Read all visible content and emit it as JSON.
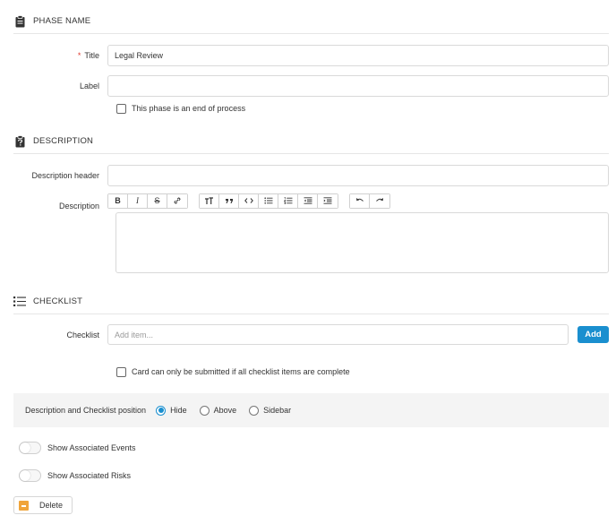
{
  "phase": {
    "section_title": "PHASE NAME",
    "title_label": "Title",
    "title_required_mark": "*",
    "title_value": "Legal Review",
    "label_label": "Label",
    "label_value": "",
    "end_of_process_label": "This phase is an end of process"
  },
  "description": {
    "section_title": "DESCRIPTION",
    "header_label": "Description header",
    "header_value": "",
    "description_label": "Description",
    "toolbar": {
      "group1": [
        "B",
        "I",
        "S",
        "link"
      ],
      "group2": [
        "heading",
        "quote",
        "code",
        "bullet-list",
        "numbered-list",
        "outdent",
        "indent"
      ],
      "group3": [
        "undo",
        "redo"
      ]
    }
  },
  "checklist": {
    "section_title": "CHECKLIST",
    "label": "Checklist",
    "placeholder": "Add item...",
    "add_label": "Add",
    "require_complete_label": "Card can only be submitted if all checklist items are complete"
  },
  "position": {
    "label": "Description and Checklist position",
    "options": [
      "Hide",
      "Above",
      "Sidebar"
    ],
    "selected": "Hide"
  },
  "toggles": {
    "events_label": "Show Associated Events",
    "risks_label": "Show Associated Risks"
  },
  "actions": {
    "delete_label": "Delete"
  },
  "colors": {
    "accent": "#1a8fcf",
    "required": "#e03c31",
    "delete_icon": "#f0a43a"
  }
}
